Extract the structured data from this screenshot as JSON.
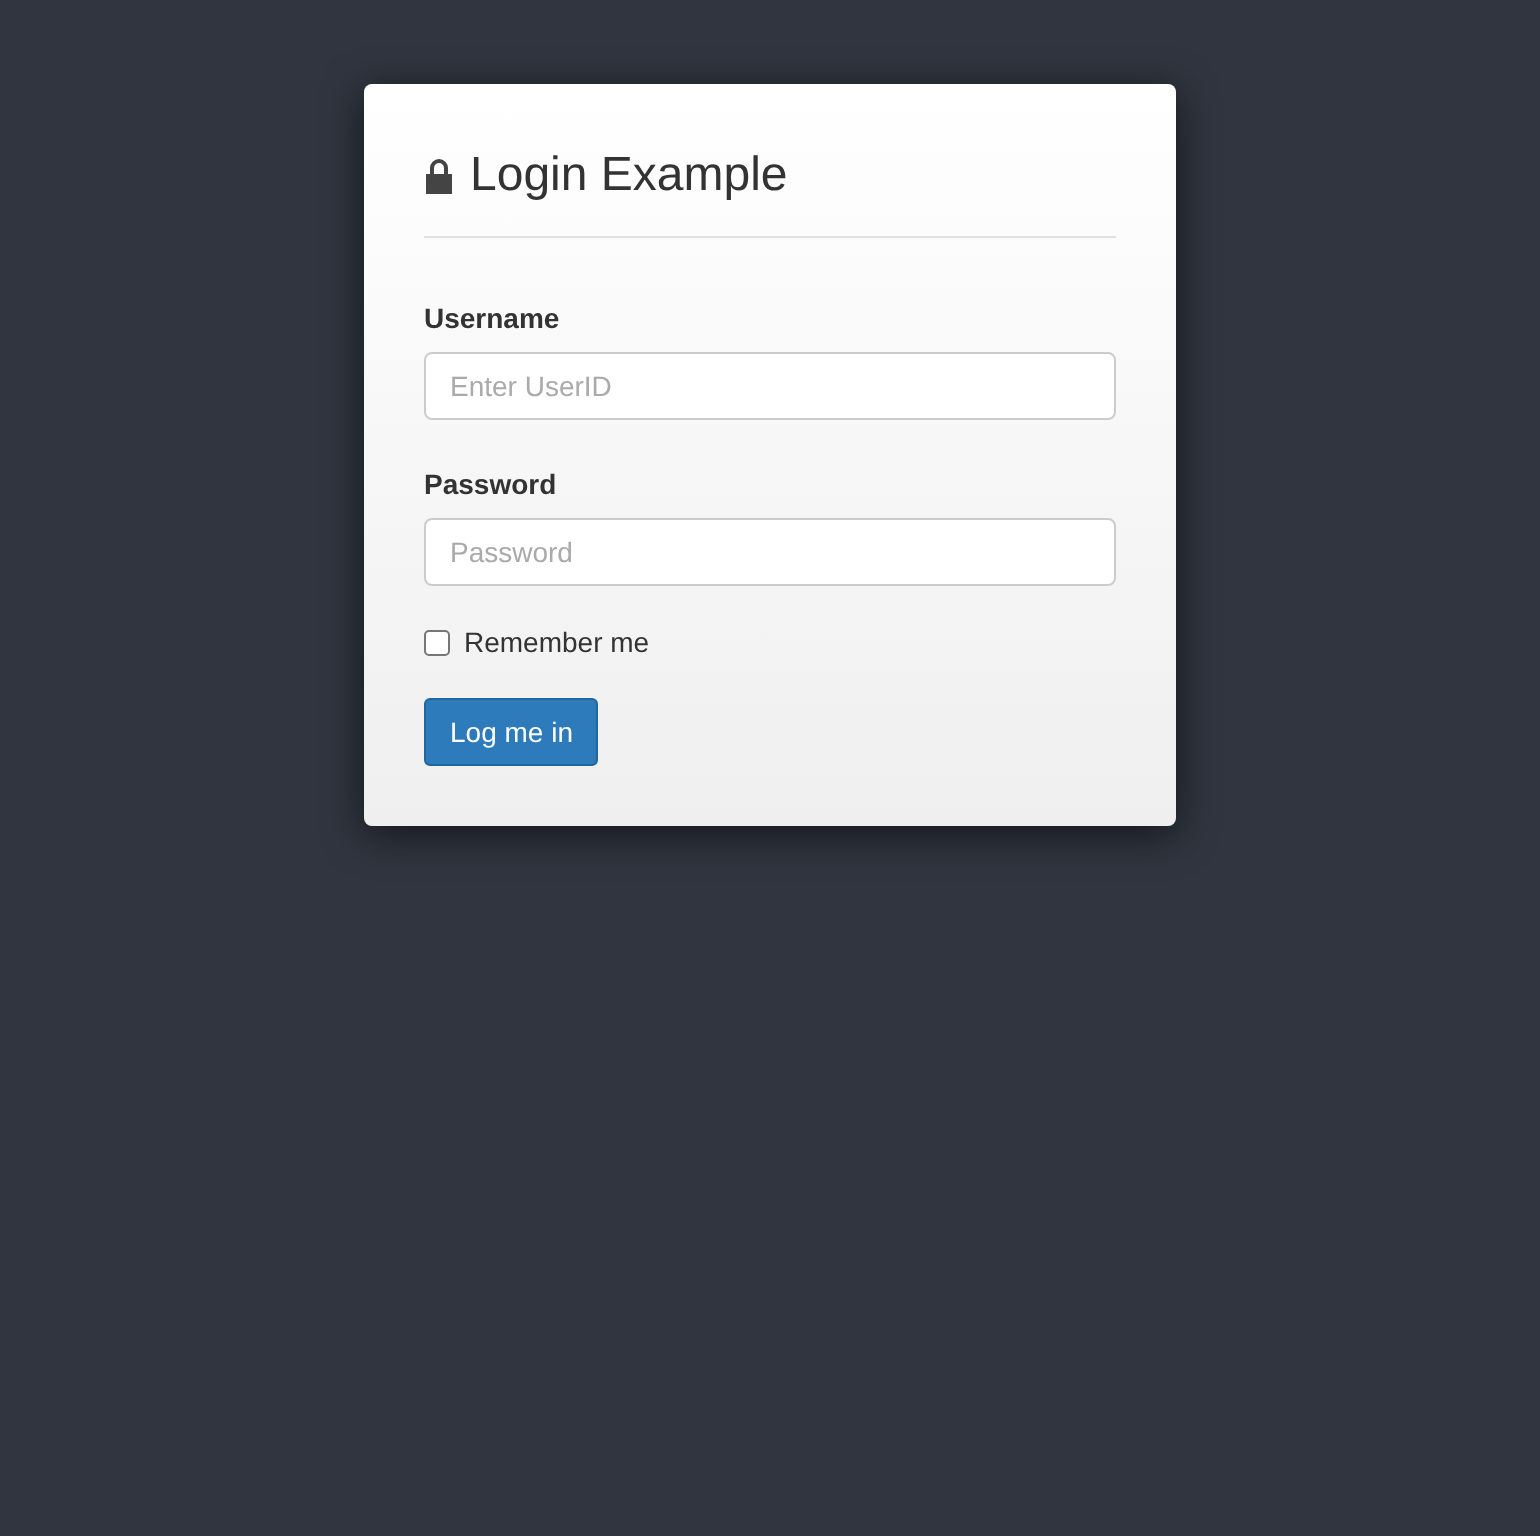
{
  "form": {
    "title": "Login Example",
    "fields": [
      {
        "label": "Username",
        "placeholder": "Enter UserID"
      },
      {
        "label": "Password",
        "placeholder": "Password"
      }
    ],
    "remember": {
      "label": "Remember me",
      "checked": false
    },
    "submit": {
      "label": "Log me in"
    }
  }
}
